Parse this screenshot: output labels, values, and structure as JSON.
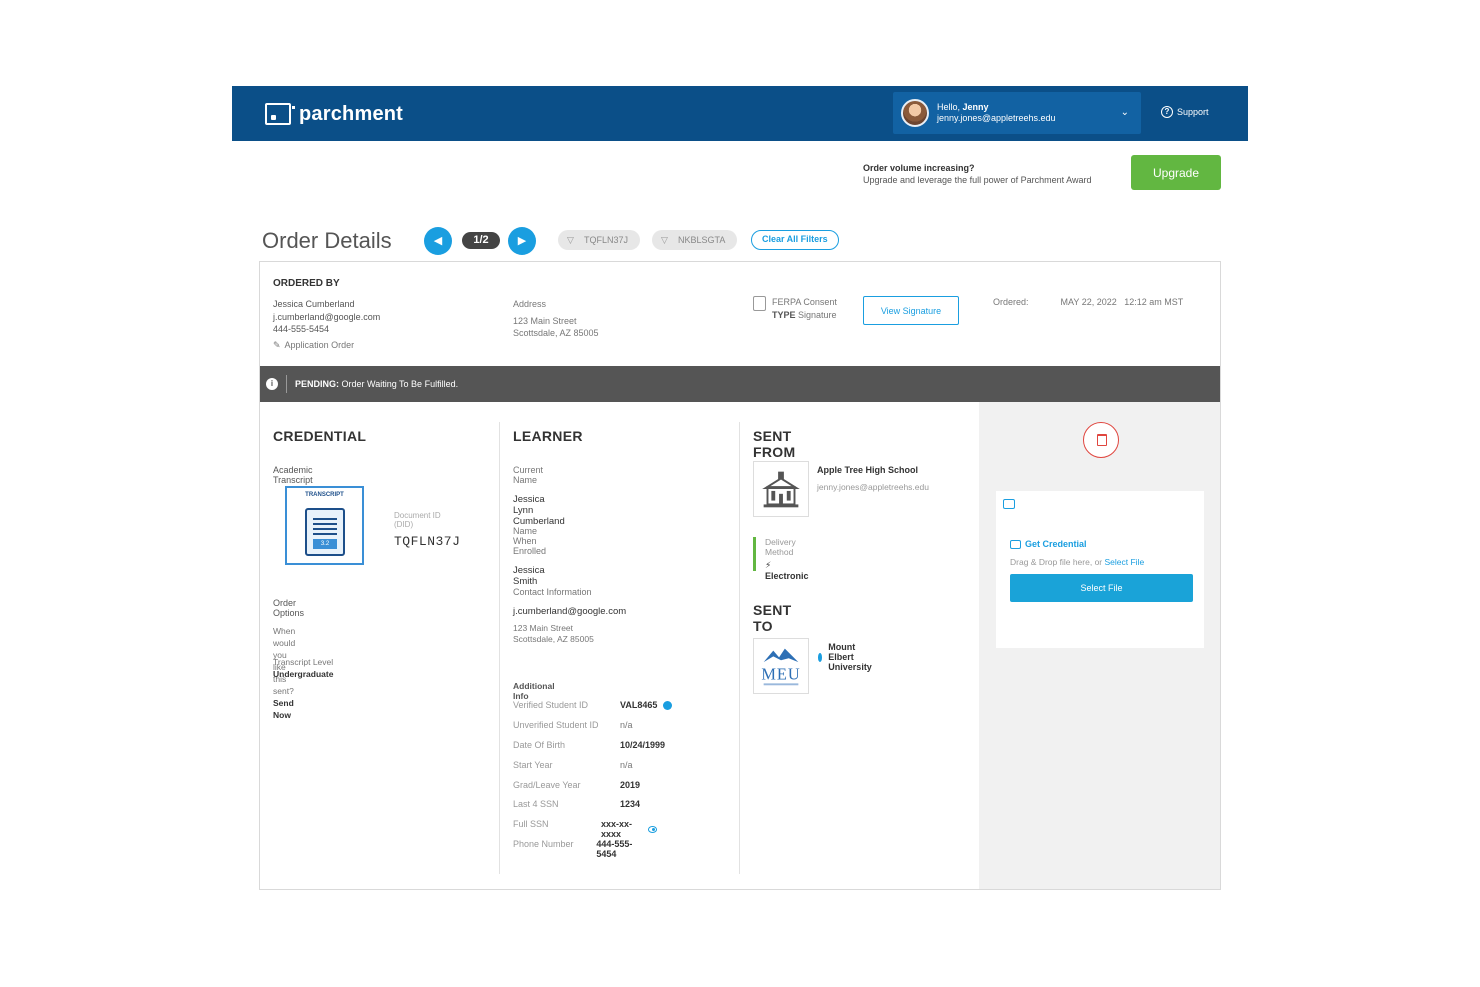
{
  "header": {
    "logo_text": "parchment",
    "greeting": "Hello, ",
    "user_name": "Jenny",
    "user_email": "jenny.jones@appletreehs.edu",
    "support_label": "Support"
  },
  "upgrade": {
    "title": "Order volume increasing?",
    "subtitle": "Upgrade and leverage the full power of Parchment Award",
    "button_label": "Upgrade"
  },
  "order_nav": {
    "title": "Order Details",
    "pager": "1/2",
    "filters": [
      "TQFLN37J",
      "NKBLSGTA"
    ],
    "clear_filters_label": "Clear All Filters"
  },
  "ordered_by": {
    "heading": "ORDERED BY",
    "name": "Jessica Cumberland",
    "email": "j.cumberland@google.com",
    "phone": "444-555-5454",
    "order_type": "Application Order"
  },
  "address": {
    "label": "Address",
    "line1": "123 Main Street",
    "line2": "Scottsdale, AZ 85005"
  },
  "ferpa": {
    "label": "FERPA Consent",
    "type_label": "TYPE",
    "type_value": "Signature",
    "view_button": "View Signature"
  },
  "ordered": {
    "label": "Ordered:",
    "date": "MAY 22, 2022",
    "time": "12:12 am MST"
  },
  "status": {
    "state": "PENDING:",
    "message": "Order Waiting To Be Fulfilled."
  },
  "credential": {
    "heading": "CREDENTIAL",
    "type": "Academic Transcript",
    "thumb_label": "TRANSCRIPT",
    "thumb_gpa": "3.2",
    "doc_id_label": "Document ID (DID)",
    "doc_id": "TQFLN37J",
    "options_label": "Order Options",
    "when_label": "When would you like this sent?",
    "when_value": "Send Now",
    "level_label": "Transcript Level",
    "level_value": "Undergraduate"
  },
  "learner": {
    "heading": "LEARNER",
    "current_name_label": "Current Name",
    "current_name": "Jessica Lynn Cumberland",
    "enrolled_name_label": "Name When Enrolled",
    "enrolled_name": "Jessica Smith",
    "contact_label": "Contact Information",
    "contact_email": "j.cumberland@google.com",
    "contact_addr1": "123 Main Street",
    "contact_addr2": "Scottsdale, AZ 85005",
    "additional_label": "Additional Info",
    "additional": [
      {
        "label": "Verified Student ID",
        "value": "VAL8465"
      },
      {
        "label": "Unverified Student ID",
        "value": "n/a"
      },
      {
        "label": "Date Of Birth",
        "value": "10/24/1999"
      },
      {
        "label": "Start Year",
        "value": "n/a"
      },
      {
        "label": "Grad/Leave Year",
        "value": "2019"
      },
      {
        "label": "Last 4 SSN",
        "value": "1234"
      },
      {
        "label": "Full SSN",
        "value": "xxx-xx-xxxx"
      },
      {
        "label": "Phone Number",
        "value": "444-555-5454"
      }
    ]
  },
  "sent_from": {
    "heading": "SENT FROM",
    "school": "Apple Tree High School",
    "email": "jenny.jones@appletreehs.edu",
    "delivery_label": "Delivery Method",
    "delivery_value": "Electronic"
  },
  "sent_to": {
    "heading": "SENT TO",
    "logo_text": "MEU",
    "school": "Mount Elbert University"
  },
  "upload": {
    "get_credential": "Get Credential",
    "drop_text": "Drag & Drop file here, or ",
    "select_link": "Select File",
    "select_button": "Select File"
  },
  "colors": {
    "header_bg": "#0b4f88",
    "accent": "#1a9ee0",
    "upgrade_green": "#62b741",
    "status_bar": "#555555",
    "delete_red": "#e0463f"
  }
}
